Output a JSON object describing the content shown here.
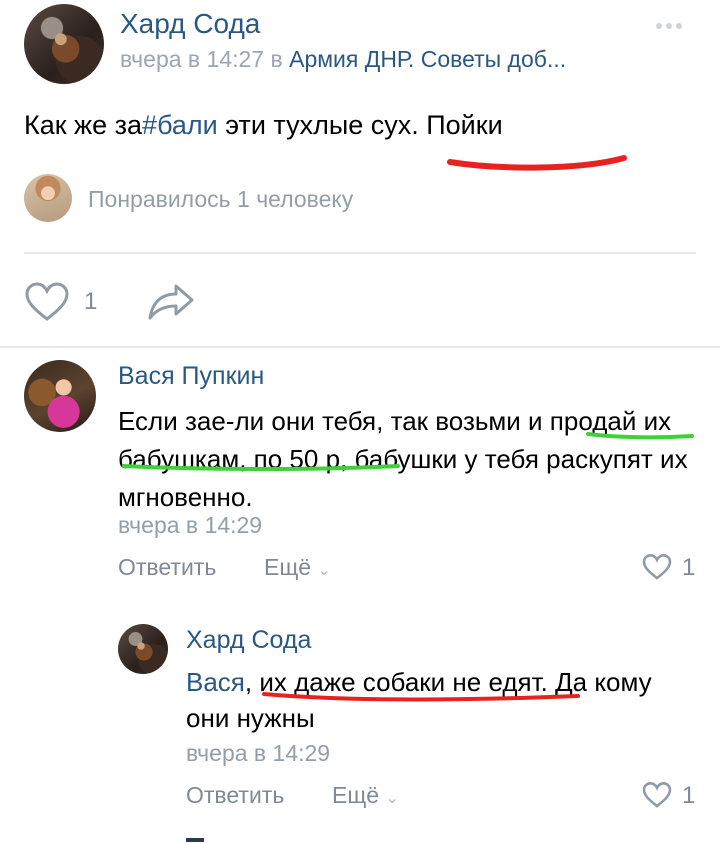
{
  "post": {
    "author": "Хард Сода",
    "meta_time": "вчера в 14:27 в",
    "group": "Армия ДНР. Советы доб...",
    "text": {
      "before": "Как же за",
      "hashtag": "#бали",
      "after": " эти тухлые сух. Пойки"
    },
    "likes_summary": "Понравилось 1 человеку",
    "like_count": "1"
  },
  "comments": [
    {
      "author": "Вася Пупкин",
      "text": "Если зае-ли они тебя, так возьми и продай их бабушкам, по 50 р, бабушки у тебя раскупят их мгновенно.",
      "time": "вчера в 14:29",
      "reply_label": "Ответить",
      "more_label": "Ещё",
      "like_count": "1"
    },
    {
      "author": "Хард Сода",
      "mention": "Вася",
      "text": ", их даже собаки не едят. Да кому они нужны",
      "time": "вчера в 14:29",
      "reply_label": "Ответить",
      "more_label": "Ещё",
      "like_count": "1"
    }
  ],
  "colors": {
    "link": "#2a5885",
    "muted": "#939ea9",
    "underline_red": "#e8231f",
    "underline_green": "#3fd13a"
  }
}
